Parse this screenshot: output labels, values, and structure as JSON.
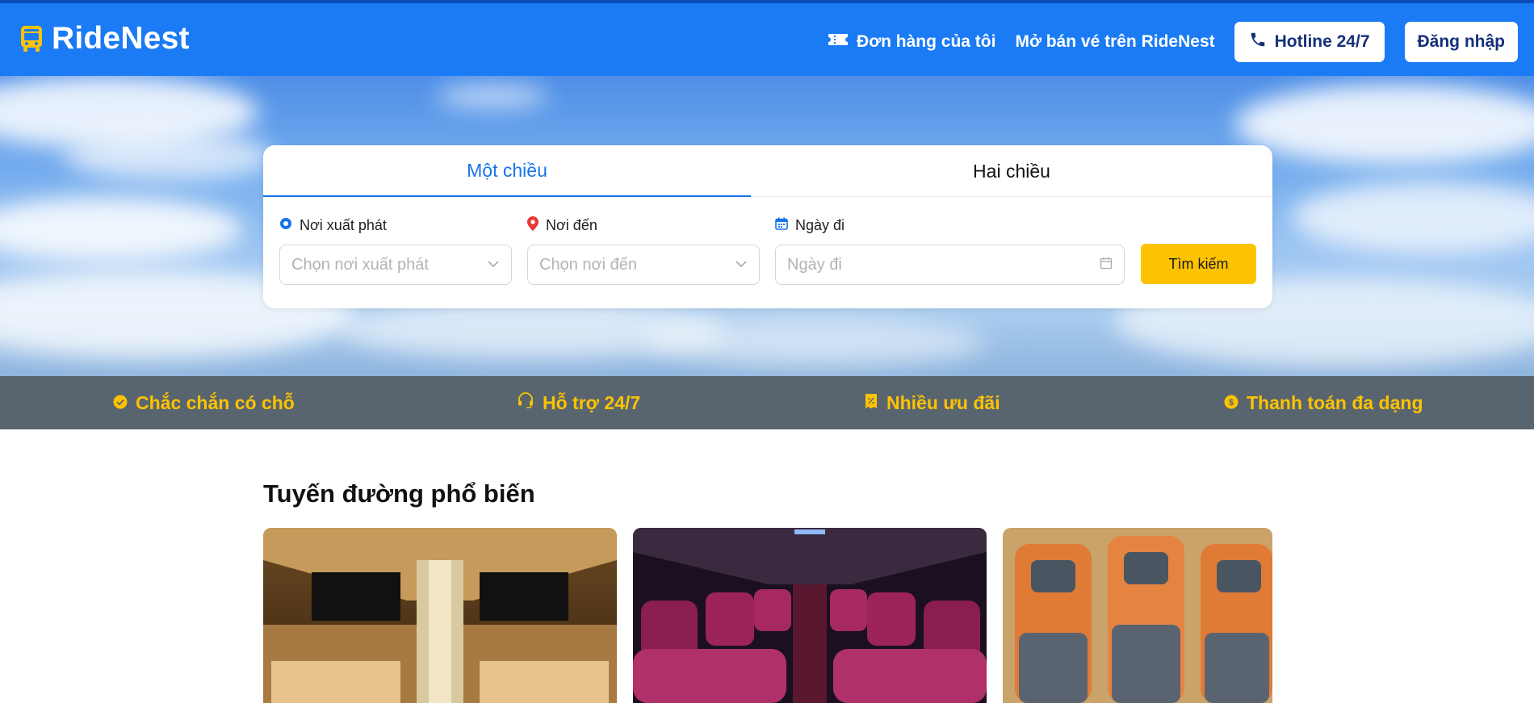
{
  "header": {
    "logo_text": "RideNest",
    "my_orders": "Đơn hàng của tôi",
    "sell_tickets": "Mở bán vé trên RideNest",
    "hotline": "Hotline 24/7",
    "login": "Đăng nhập"
  },
  "search": {
    "tabs": [
      {
        "label": "Một chiều",
        "active": true
      },
      {
        "label": "Hai chiều",
        "active": false
      }
    ],
    "origin": {
      "label": "Nơi xuất phát",
      "placeholder": "Chọn nơi xuất phát"
    },
    "destination": {
      "label": "Nơi đến",
      "placeholder": "Chọn nơi đến"
    },
    "date": {
      "label": "Ngày đi",
      "placeholder": "Ngày đi"
    },
    "button": "Tìm kiếm"
  },
  "features": [
    {
      "icon": "check-circle-icon",
      "label": "Chắc chắn có chỗ"
    },
    {
      "icon": "headset-icon",
      "label": "Hỗ trợ 24/7"
    },
    {
      "icon": "discount-icon",
      "label": "Nhiều ưu đãi"
    },
    {
      "icon": "coin-icon",
      "label": "Thanh toán đa dạng"
    }
  ],
  "popular_routes": {
    "title": "Tuyến đường phổ biến"
  },
  "colors": {
    "header_bg": "#1a7bf5",
    "accent_yellow": "#fdc303",
    "active_tab": "#1a73e8",
    "feature_strip": "#59656e"
  }
}
